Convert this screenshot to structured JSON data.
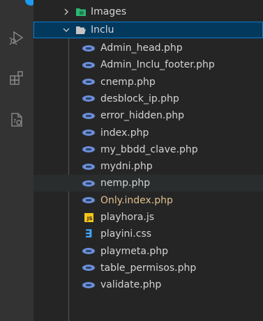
{
  "explorer": {
    "images_folder": {
      "label": "Images",
      "expanded": false
    },
    "inclu_folder": {
      "label": "Inclu",
      "expanded": true
    },
    "files": [
      {
        "label": "Admin_head.php",
        "icon": "php-icon",
        "modified": false,
        "hover": false
      },
      {
        "label": "Admin_Inclu_footer.php",
        "icon": "php-icon",
        "modified": false,
        "hover": false
      },
      {
        "label": "cnemp.php",
        "icon": "php-icon",
        "modified": false,
        "hover": false
      },
      {
        "label": "desblock_ip.php",
        "icon": "php-icon",
        "modified": false,
        "hover": false
      },
      {
        "label": "error_hidden.php",
        "icon": "php-icon",
        "modified": false,
        "hover": false
      },
      {
        "label": "index.php",
        "icon": "php-icon",
        "modified": false,
        "hover": false
      },
      {
        "label": "my_bbdd_clave.php",
        "icon": "php-icon",
        "modified": false,
        "hover": false
      },
      {
        "label": "mydni.php",
        "icon": "php-icon",
        "modified": false,
        "hover": false
      },
      {
        "label": "nemp.php",
        "icon": "php-icon",
        "modified": false,
        "hover": true
      },
      {
        "label": "Only.index.php",
        "icon": "php-icon",
        "modified": true,
        "hover": false
      },
      {
        "label": "playhora.js",
        "icon": "js-icon",
        "modified": false,
        "hover": false
      },
      {
        "label": "playini.css",
        "icon": "css-icon",
        "modified": false,
        "hover": false
      },
      {
        "label": "playmeta.php",
        "icon": "php-icon",
        "modified": false,
        "hover": false
      },
      {
        "label": "table_permisos.php",
        "icon": "php-icon",
        "modified": false,
        "hover": false
      },
      {
        "label": "validate.php",
        "icon": "php-icon",
        "modified": false,
        "hover": false
      }
    ]
  },
  "icons": {
    "js_badge_text": "JS",
    "css_glyph": "∃"
  },
  "colors": {
    "selection": "#04395e",
    "selection_border": "#007fd4",
    "modified_text": "#e2c08d",
    "php": "#6b8fd6",
    "js": "#f5c518",
    "css": "#42a5f5",
    "folder": "#c5c5c5",
    "images_folder": "#2bb673"
  }
}
